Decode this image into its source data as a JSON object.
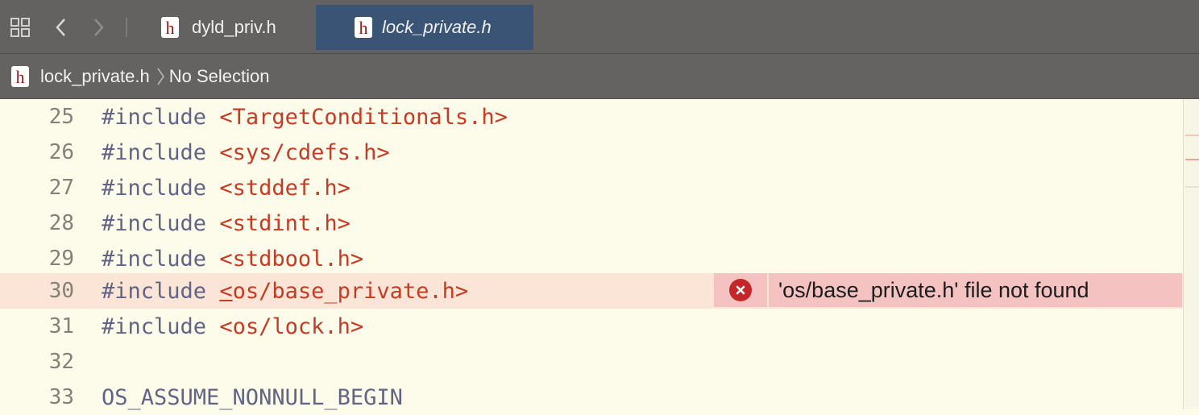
{
  "tabs": [
    {
      "label": "dyld_priv.h",
      "icon": "h-file-icon",
      "active": false
    },
    {
      "label": "lock_private.h",
      "icon": "h-file-icon",
      "active": true
    }
  ],
  "jumpbar": {
    "file": "lock_private.h",
    "selection": "No Selection"
  },
  "lines": [
    {
      "num": "25",
      "kw": "#include ",
      "arg": "<TargetConditionals.h>"
    },
    {
      "num": "26",
      "kw": "#include ",
      "arg": "<sys/cdefs.h>"
    },
    {
      "num": "27",
      "kw": "#include ",
      "arg": "<stddef.h>"
    },
    {
      "num": "28",
      "kw": "#include ",
      "arg": "<stdint.h>"
    },
    {
      "num": "29",
      "kw": "#include ",
      "arg": "<stdbool.h>"
    },
    {
      "num": "30",
      "kw": "#include ",
      "arg_first": "<",
      "arg_rest": "os/base_private.h>"
    },
    {
      "num": "31",
      "kw": "#include ",
      "arg": "<os/lock.h>"
    },
    {
      "num": "32",
      "kw": "",
      "arg": ""
    },
    {
      "num": "33",
      "kw": "OS_ASSUME_NONNULL_BEGIN",
      "arg": ""
    }
  ],
  "error": {
    "message": "'os/base_private.h' file not found",
    "color": "#c5262a",
    "background": "#f5c2c2"
  },
  "colors": {
    "tabbar": "#636260",
    "active_tab": "#3a5476",
    "editor_bg": "#fdfbea",
    "keyword": "#626485",
    "string": "#c63b24"
  }
}
